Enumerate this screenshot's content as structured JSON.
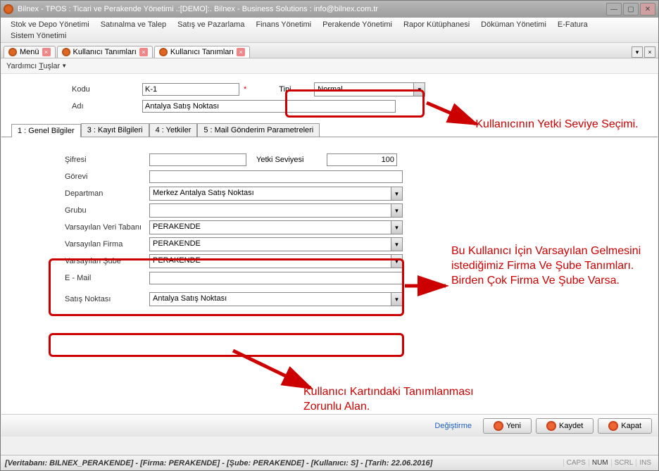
{
  "title": "Bilnex - TPOS : Ticari ve Perakende Yönetimi     .:[DEMO]:.     Bilnex - Business Solutions : info@bilnex.com.tr",
  "menubar": [
    "Stok ve Depo Yönetimi",
    "Satınalma ve Talep",
    "Satış ve Pazarlama",
    "Finans Yönetimi",
    "Perakende Yönetimi",
    "Rapor Kütüphanesi",
    "Döküman Yönetimi",
    "E-Fatura",
    "Sistem Yönetimi"
  ],
  "tabs": [
    {
      "label": "Menü"
    },
    {
      "label": "Kullanıcı Tanımları"
    },
    {
      "label": "Kullanıcı Tanımları",
      "active": true
    }
  ],
  "aux_toolbar": {
    "label_pre": "Yardımcı ",
    "label_under": "T",
    "label_post": "uşlar"
  },
  "header": {
    "kodu_label": "Kodu",
    "kodu_value": "K-1",
    "adi_label": "Adı",
    "adi_value": "Antalya Satış Noktası",
    "tipi_label": "Tipi",
    "tipi_value": "Normal"
  },
  "inner_tabs": [
    "1 : Genel Bilgiler",
    "3 : Kayıt Bilgileri",
    "4 : Yetkiler",
    "5 : Mail Gönderim Parametreleri"
  ],
  "details": {
    "sifresi_label": "Şifresi",
    "sifresi_value": "",
    "yetki_label": "Yetki Seviyesi",
    "yetki_value": "100",
    "gorevi_label": "Görevi",
    "gorevi_value": "",
    "departman_label": "Departman",
    "departman_value": "Merkez Antalya Satış Noktası",
    "grubu_label": "Grubu",
    "grubu_value": "",
    "vvt_label": "Varsayılan Veri Tabanı",
    "vvt_value": "PERAKENDE",
    "vf_label": "Varsayılan Firma",
    "vf_value": "PERAKENDE",
    "vs_label": "Varsayılan Şube",
    "vs_value": "PERAKENDE",
    "email_label": "E - Mail",
    "email_value": "",
    "sn_label": "Satış Noktası",
    "sn_value": "Antalya Satış Noktası"
  },
  "actions": {
    "degistirme": "Değiştirme",
    "yeni": "Yeni",
    "kaydet": "Kaydet",
    "kapat": "Kapat"
  },
  "statusbar": {
    "text": "[Veritabanı: BILNEX_PERAKENDE] - [Firma: PERAKENDE] - [Şube: PERAKENDE] - [Kullanıcı: S] - [Tarih: 22.06.2016]",
    "caps": "CAPS",
    "num": "NUM",
    "scrl": "SCRL",
    "ins": "INS"
  },
  "annotations": {
    "a1": "Kullanıcının Yetki Seviye Seçimi.",
    "a2": "Bu Kullanıcı İçin Varsayılan Gelmesini istediğimiz Firma Ve Şube Tanımları.\nBirden Çok Firma Ve Şube Varsa.",
    "a3": "Kullanıcı Kartındaki Tanımlanması Zorunlu Alan."
  }
}
